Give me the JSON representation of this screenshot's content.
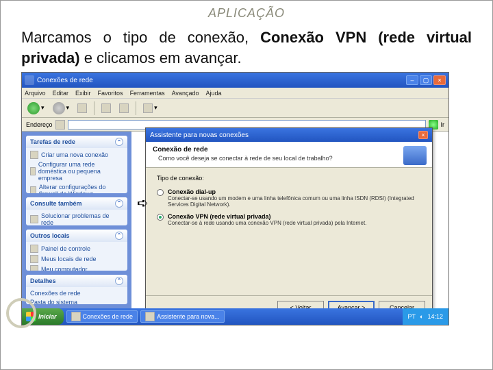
{
  "slide": {
    "title": "APLICAÇÃO",
    "text_prefix": "Marcamos o tipo de conexão, ",
    "text_bold": "Conexão VPN (rede virtual privada)",
    "text_suffix": " e clicamos em avançar."
  },
  "window": {
    "title": "Conexões de rede",
    "menu": [
      "Arquivo",
      "Editar",
      "Exibir",
      "Favoritos",
      "Ferramentas",
      "Avançado",
      "Ajuda"
    ],
    "address_label": "Endereço",
    "go_label": "Ir"
  },
  "sidebar": {
    "panels": [
      {
        "title": "Tarefas de rede",
        "items": [
          "Criar uma nova conexão",
          "Configurar uma rede doméstica ou pequena empresa",
          "Alterar configurações do firewall do Windows"
        ]
      },
      {
        "title": "Consulte também",
        "items": [
          "Solucionar problemas de rede"
        ]
      },
      {
        "title": "Outros locais",
        "items": [
          "Painel de controle",
          "Meus locais de rede",
          "Meu computador"
        ]
      },
      {
        "title": "Detalhes",
        "items": [
          "Conexões de rede",
          "Pasta do sistema"
        ]
      }
    ]
  },
  "dialog": {
    "title": "Assistente para novas conexões",
    "heading": "Conexão de rede",
    "subheading": "Como você deseja se conectar à rede de seu local de trabalho?",
    "group_label": "Tipo de conexão:",
    "options": [
      {
        "title": "Conexão dial-up",
        "desc": "Conectar-se usando um modem e uma linha telefônica comum ou uma linha ISDN (RDSI) (Integrated Services Digital Network).",
        "selected": false
      },
      {
        "title": "Conexão VPN (rede virtual privada)",
        "desc": "Conectar-se à rede usando uma conexão VPN (rede virtual privada) pela Internet.",
        "selected": true
      }
    ],
    "buttons": {
      "back": "< Voltar",
      "next": "Avançar >",
      "cancel": "Cancelar"
    }
  },
  "taskbar": {
    "start": "Iniciar",
    "tasks": [
      "Conexões de rede",
      "Assistente para nova..."
    ],
    "time": "14:12",
    "lang": "PT"
  },
  "arrow_glyph": "➪"
}
